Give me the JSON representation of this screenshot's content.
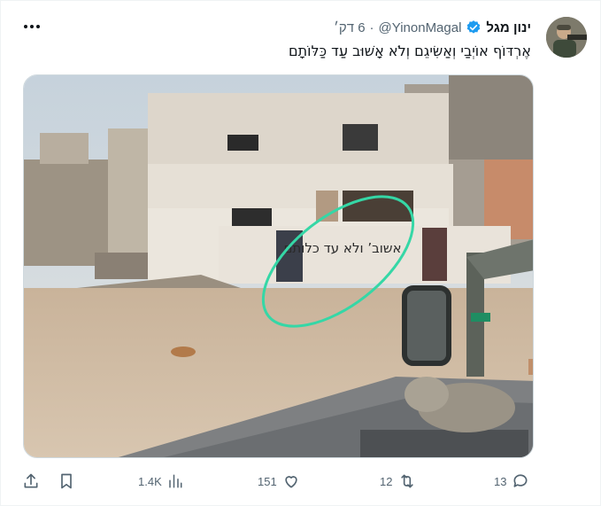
{
  "author": {
    "display_name": "ינון מגל",
    "handle": "@YinonMagal",
    "separator": "·",
    "time": "6 דק׳",
    "verified": true
  },
  "tweet": {
    "text": "אֶרְדּוֹף אוֹיְבַי וְאַשִּׂיגֵם וְלֹא אָשׁוּב עַד כַּלּוֹתָם"
  },
  "media": {
    "graffiti_text": "אשובʼ ולא עד כלותם"
  },
  "actions": {
    "replies": "13",
    "retweets": "12",
    "likes": "151",
    "views": "1.4K"
  },
  "colors": {
    "verified": "#1d9bf0",
    "secondary_text": "#536471",
    "highlight_circle": "#35d7a6"
  }
}
